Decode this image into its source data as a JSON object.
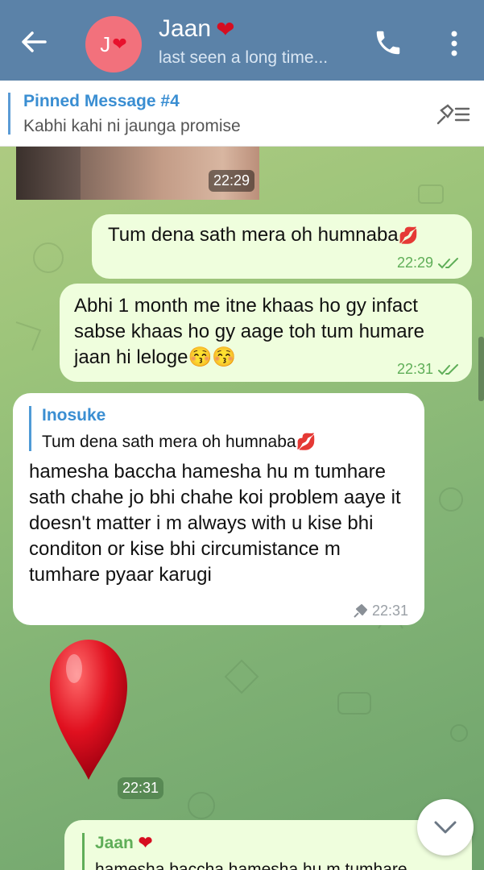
{
  "header": {
    "avatar_letter": "J",
    "title": "Jaan",
    "status": "last seen a long time..."
  },
  "pinned": {
    "title": "Pinned Message #4",
    "text": "Kabhi kahi ni jaunga promise"
  },
  "messages": {
    "photo_time": "22:29",
    "m1_text": "Tum dena sath mera oh humnaba",
    "m1_time": "22:29",
    "m2_text": "Abhi 1 month me itne khaas ho gy infact sabse khaas ho gy  aage toh tum humare jaan hi leloge",
    "m2_time": "22:31",
    "m3_reply_name": "Inosuke",
    "m3_reply_text": "Tum dena sath mera oh humnaba",
    "m3_text": "hamesha baccha hamesha hu m tumhare sath chahe jo bhi chahe koi problem aaye it doesn't matter i m always with u kise bhi  conditon or kise bhi circumistance m tumhare pyaar karugi",
    "m3_time": "22:31",
    "balloon_time": "22:31",
    "m4_reply_name": "Jaan",
    "m4_reply_text_partial": "hamesha baccha hamesha hu m tumhare"
  },
  "icons": {
    "back": "back-arrow-icon",
    "call": "phone-icon",
    "menu": "more-vertical-icon",
    "unpin": "unpin-list-icon",
    "scroll": "chevron-down-icon"
  },
  "colors": {
    "header": "#5b82a8",
    "outgoing_bubble": "#effedd",
    "incoming_bubble": "#ffffff",
    "link_blue": "#3a8ed2",
    "check_green": "#5fae58"
  }
}
